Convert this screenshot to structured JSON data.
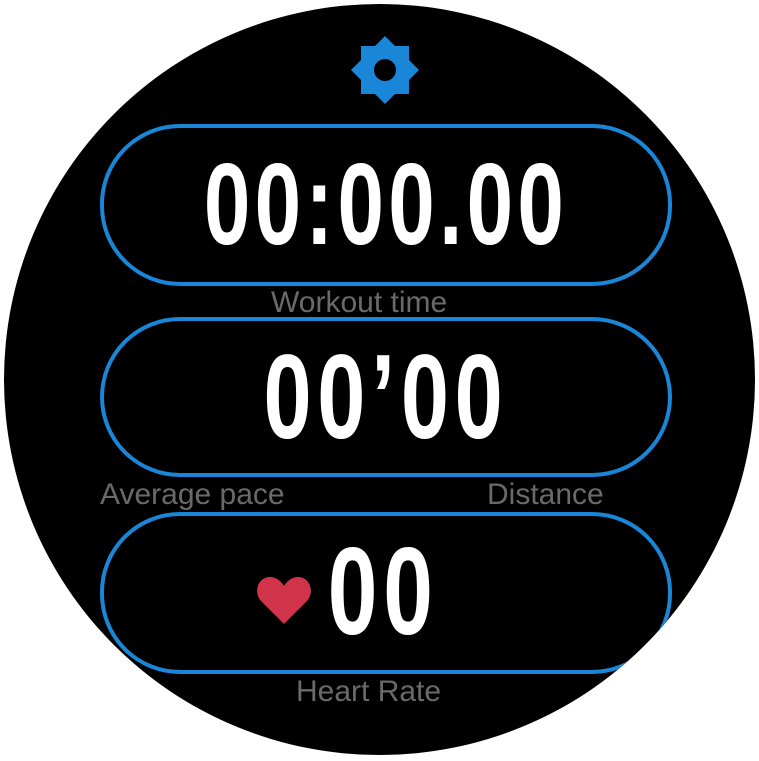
{
  "workout": {
    "time_value": "00:00.00",
    "time_label": "Workout time",
    "pace_value": "00’00",
    "pace_label": "Average pace",
    "distance_label": "Distance",
    "heart_rate_value": "00",
    "heart_rate_label": "Heart Rate"
  },
  "icons": {
    "settings": "gear-icon",
    "heart": "heart-icon"
  },
  "colors": {
    "accent": "#1a86d8",
    "background": "#000000",
    "value_text": "#ffffff",
    "label_text": "#6a6a6a",
    "heart": "#d0334a"
  }
}
